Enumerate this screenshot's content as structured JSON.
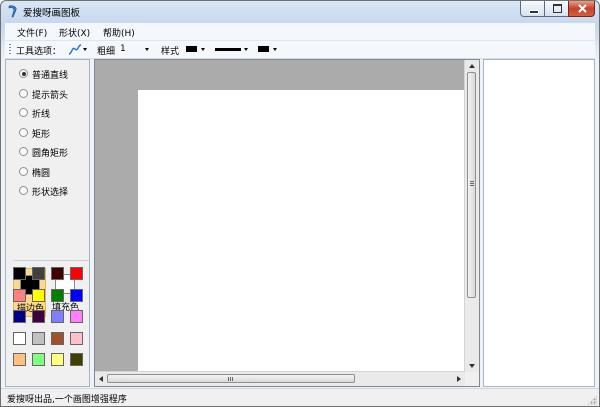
{
  "window": {
    "title": "爱搜呀画图板"
  },
  "menu": {
    "file": "文件(F)",
    "shape": "形状(X)",
    "help": "帮助(H)"
  },
  "toolbar": {
    "tool_options": "工具选项：",
    "thickness_label": "粗细",
    "thickness_value": "1",
    "style_label": "样式"
  },
  "tools": [
    {
      "label": "普通直线",
      "selected": true
    },
    {
      "label": "提示箭头",
      "selected": false
    },
    {
      "label": "折线",
      "selected": false
    },
    {
      "label": "矩形",
      "selected": false
    },
    {
      "label": "圆角矩形",
      "selected": false
    },
    {
      "label": "椭圆",
      "selected": false
    },
    {
      "label": "形状选择",
      "selected": false
    }
  ],
  "color_selectors": {
    "stroke": {
      "label": "描边色",
      "color": "#000000"
    },
    "fill": {
      "label": "填充色",
      "color": "#ffffff"
    }
  },
  "palette": [
    "#000000",
    "#404040",
    "#400000",
    "#ff0000",
    "#ff8080",
    "#ffff00",
    "#008000",
    "#0000ff",
    "#000080",
    "#400040",
    "#8080ff",
    "#ff80ff",
    "#ffffff",
    "#c0c0c0",
    "#a0522d",
    "#ffc0cb",
    "#ffc080",
    "#80ff80",
    "#ffff80",
    "#404000"
  ],
  "status": {
    "text": "爱搜呀出品,一个画图增强程序"
  }
}
